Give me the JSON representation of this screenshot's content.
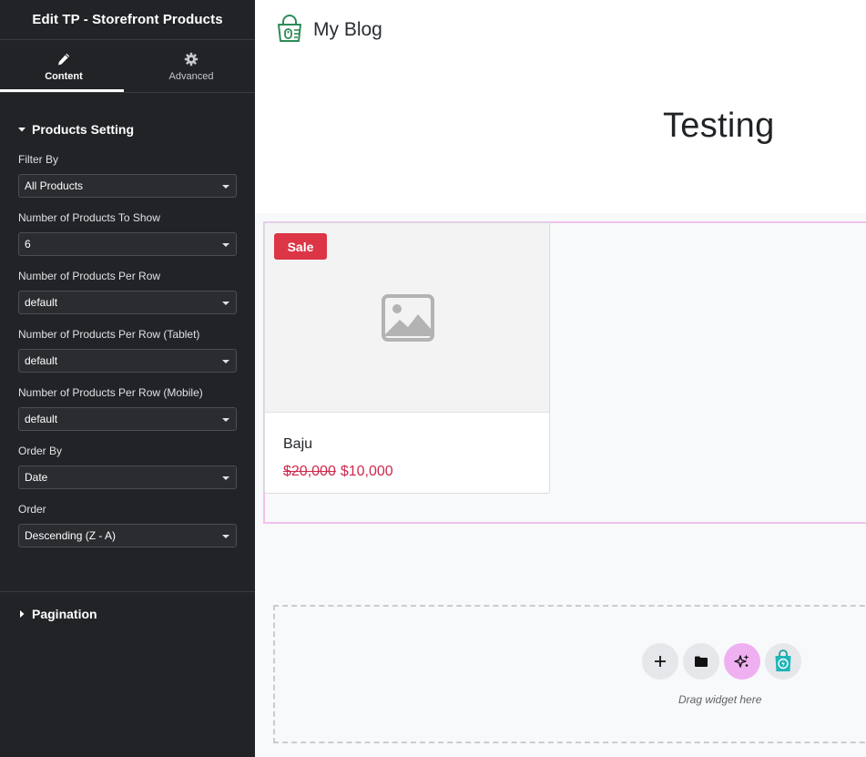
{
  "panel": {
    "title": "Edit TP - Storefront Products",
    "tabs": [
      {
        "label": "Content",
        "icon": "pencil-icon"
      },
      {
        "label": "Advanced",
        "icon": "gear-icon"
      }
    ],
    "sections": {
      "products": {
        "title": "Products Setting",
        "expanded": true
      },
      "pagination": {
        "title": "Pagination",
        "expanded": false
      }
    },
    "fields": [
      {
        "label": "Filter By",
        "value": "All Products"
      },
      {
        "label": "Number of Products To Show",
        "value": "6"
      },
      {
        "label": "Number of Products Per Row",
        "value": "default"
      },
      {
        "label": "Number of Products Per Row (Tablet)",
        "value": "default"
      },
      {
        "label": "Number of Products Per Row (Mobile)",
        "value": "default"
      },
      {
        "label": "Order By",
        "value": "Date"
      },
      {
        "label": "Order",
        "value": "Descending (Z - A)"
      }
    ]
  },
  "site": {
    "name": "My Blog",
    "logo_icon": "shopping-bag-logo-icon",
    "page_title": "Testing"
  },
  "product": {
    "badge": "Sale",
    "name": "Baju",
    "price_old": "$20,000",
    "price_new": "$10,000",
    "image_icon": "image-placeholder-icon"
  },
  "drop_zone": {
    "hint": "Drag widget here",
    "buttons": [
      "add-section-icon",
      "folder-icon",
      "sparkle-ai-icon",
      "store-plugin-icon"
    ]
  },
  "colors": {
    "panel_bg": "#212327",
    "accent_pink": "#efc2f0",
    "sale_red": "#dc3545",
    "price_red": "#d0284b",
    "logo_green": "#2e8b57"
  }
}
